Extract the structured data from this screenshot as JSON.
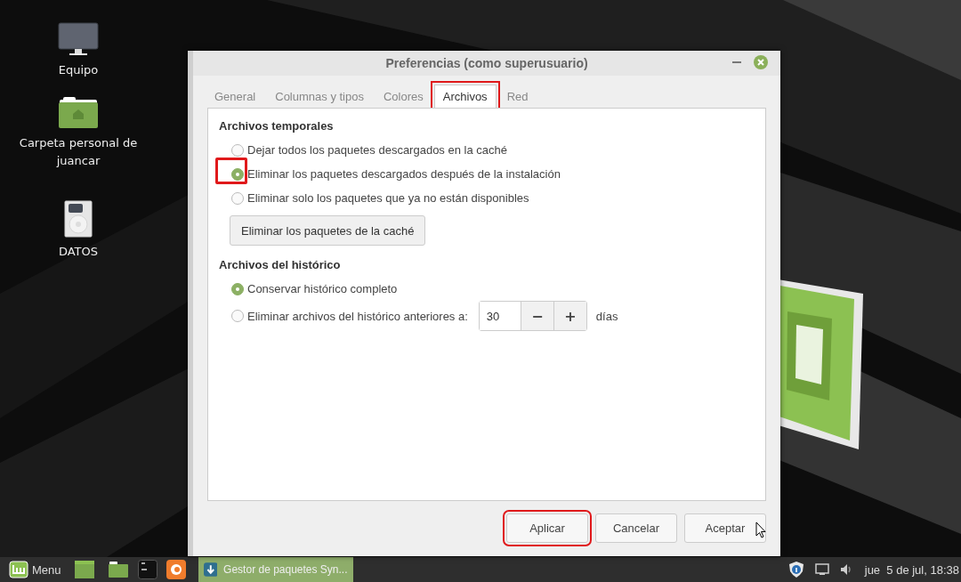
{
  "desktop": {
    "icons": [
      {
        "label": "Equipo",
        "kind": "computer"
      },
      {
        "label": "Carpeta personal de juancar",
        "kind": "home-folder"
      },
      {
        "label": "DATOS",
        "kind": "drive"
      }
    ]
  },
  "window": {
    "title": "Preferencias (como superusuario)",
    "tabs": [
      {
        "label": "General",
        "selected": false,
        "highlighted": false
      },
      {
        "label": "Columnas y tipos",
        "selected": false,
        "highlighted": false
      },
      {
        "label": "Colores",
        "selected": false,
        "highlighted": false
      },
      {
        "label": "Archivos",
        "selected": true,
        "highlighted": true
      },
      {
        "label": "Red",
        "selected": false,
        "highlighted": false
      }
    ],
    "sections": [
      {
        "heading": "Archivos temporales",
        "options": [
          {
            "label": "Dejar todos los paquetes descargados en la caché",
            "selected": false,
            "highlighted": false
          },
          {
            "label": "Eliminar los paquetes descargados después de la instalación",
            "selected": true,
            "highlighted": true
          },
          {
            "label": "Eliminar solo los paquetes que ya no están disponibles",
            "selected": false,
            "highlighted": false
          }
        ],
        "button": "Eliminar los paquetes de la caché"
      },
      {
        "heading": "Archivos del histórico",
        "options": [
          {
            "label": "Conservar histórico completo",
            "selected": true,
            "highlighted": false
          },
          {
            "label": "Eliminar archivos del histórico anteriores a:",
            "selected": false,
            "highlighted": false,
            "spin": {
              "value": "30",
              "decrement": "−",
              "increment": "+",
              "unit": "días"
            }
          }
        ]
      }
    ],
    "buttons": [
      {
        "label": "Aplicar",
        "highlighted": true
      },
      {
        "label": "Cancelar",
        "highlighted": false
      },
      {
        "label": "Aceptar",
        "highlighted": false
      }
    ]
  },
  "taskbar": {
    "menu_label": "Menu",
    "launchers": [
      {
        "kind": "show-desktop"
      },
      {
        "kind": "folder"
      },
      {
        "kind": "terminal"
      },
      {
        "kind": "browser"
      }
    ],
    "tasks": [
      {
        "label": "Gestor de paquetes Syn...",
        "selected": true
      }
    ],
    "tray": [
      {
        "kind": "shield"
      },
      {
        "kind": "display"
      },
      {
        "kind": "volume"
      }
    ],
    "clock": "jue  5 de jul, 18:38"
  }
}
